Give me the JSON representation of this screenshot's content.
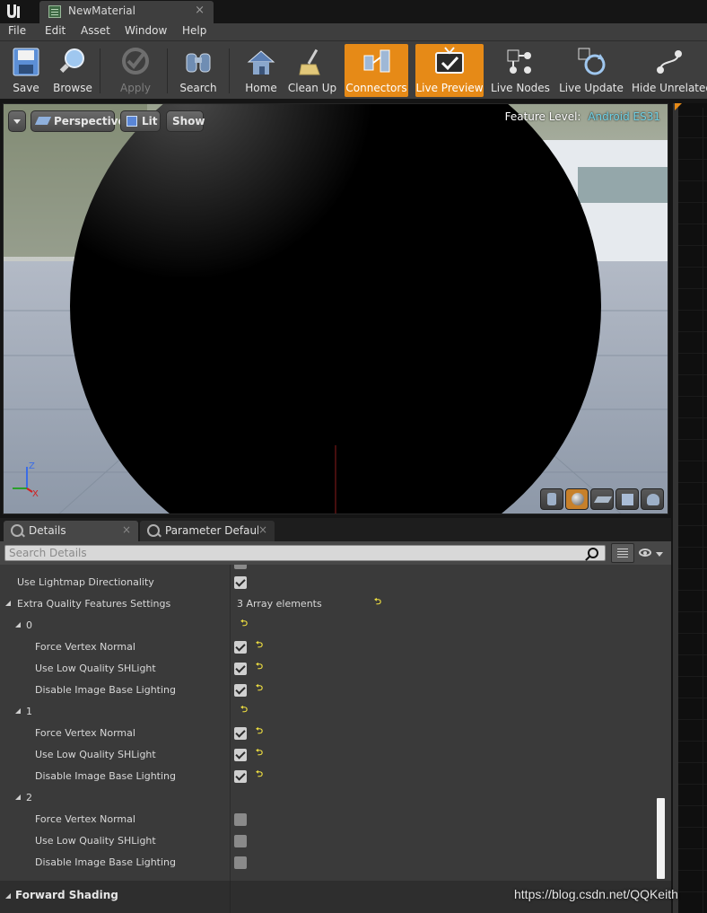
{
  "window": {
    "tab_title": "NewMaterial",
    "close_glyph": "×",
    "logo": "u"
  },
  "menu": [
    "File",
    "Edit",
    "Asset",
    "Window",
    "Help"
  ],
  "toolbar": {
    "save": "Save",
    "browse": "Browse",
    "apply": "Apply",
    "search": "Search",
    "home": "Home",
    "cleanup": "Clean Up",
    "connectors": "Connectors",
    "live_preview": "Live Preview",
    "live_nodes": "Live Nodes",
    "live_update": "Live Update",
    "hide_unrelated": "Hide Unrelated"
  },
  "viewport": {
    "perspective": "Perspective",
    "lit": "Lit",
    "show": "Show",
    "feature_level_label": "Feature Level:",
    "feature_level_value": "Android ES31",
    "axis_z": "Z",
    "axis_x": "X"
  },
  "details": {
    "tab_details": "Details",
    "tab_params": "Parameter Defaults",
    "close_glyph": "×",
    "search_placeholder": "Search Details",
    "rows": {
      "use_lightmap_dir": "Use Lightmap Directionality",
      "extra_quality": "Extra Quality Features Settings",
      "array_count": "3 Array elements",
      "idx0": "0",
      "idx1": "1",
      "idx2": "2",
      "force_vertex_normal": "Force Vertex Normal",
      "use_low_quality_shlight": "Use Low Quality SHLight",
      "disable_ibl": "Disable Image Base Lighting",
      "forward_shading": "Forward Shading"
    },
    "reset_glyph": "⮌",
    "array_states": [
      {
        "force_vertex_normal": true,
        "use_low_quality_shlight": true,
        "disable_ibl": true
      },
      {
        "force_vertex_normal": true,
        "use_low_quality_shlight": true,
        "disable_ibl": true
      },
      {
        "force_vertex_normal": false,
        "use_low_quality_shlight": false,
        "disable_ibl": false
      }
    ]
  },
  "watermark": "https://blog.csdn.net/QQKeith",
  "colors": {
    "accent": "#e68a17",
    "feature_value": "#6fd1e6",
    "reset_arrow": "#f0e040"
  }
}
